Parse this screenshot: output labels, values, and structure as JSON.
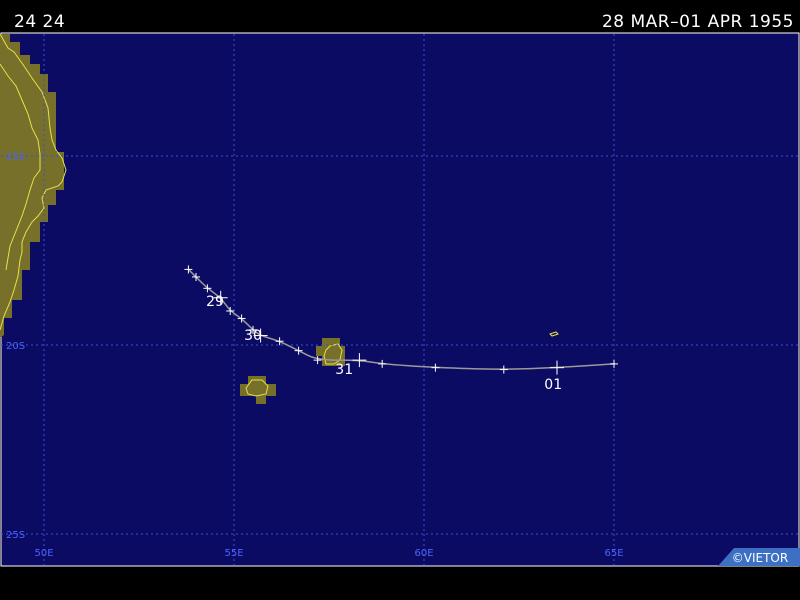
{
  "header": {
    "left_text": "24 24",
    "right_text": "28 MAR–01 APR 1955"
  },
  "map": {
    "colors": {
      "ocean": "#0b0b63",
      "land": "#76702a",
      "coast": "#e8e04a",
      "grid": "#3a4fd8",
      "grid_label": "#4b63ff",
      "track": "#9a9a9a",
      "marker": "#ffffff",
      "badge_bg": "#3d6fc4"
    },
    "lat_labels": [
      {
        "lat": -15,
        "text": "15S"
      },
      {
        "lat": -20,
        "text": "20S"
      },
      {
        "lat": -25,
        "text": "25S"
      }
    ],
    "lon_labels": [
      {
        "lon": 50,
        "text": "50E"
      },
      {
        "lon": 55,
        "text": "55E"
      },
      {
        "lon": 60,
        "text": "60E"
      },
      {
        "lon": 65,
        "text": "65E"
      }
    ],
    "day_labels": [
      {
        "text": "29",
        "lon": 54.5,
        "lat": -18.6
      },
      {
        "text": "30",
        "lon": 55.5,
        "lat": -19.5
      },
      {
        "text": "31",
        "lon": 57.9,
        "lat": -20.4
      },
      {
        "text": "01",
        "lon": 63.4,
        "lat": -20.8
      }
    ],
    "track_points": [
      {
        "lon": 53.8,
        "lat": -18.0
      },
      {
        "lon": 54.0,
        "lat": -18.2
      },
      {
        "lon": 54.3,
        "lat": -18.5
      },
      {
        "lon": 54.65,
        "lat": -18.75,
        "day_start": true
      },
      {
        "lon": 54.9,
        "lat": -19.1
      },
      {
        "lon": 55.2,
        "lat": -19.3
      },
      {
        "lon": 55.5,
        "lat": -19.6
      },
      {
        "lon": 55.7,
        "lat": -19.75,
        "day_start": true
      },
      {
        "lon": 56.2,
        "lat": -19.9
      },
      {
        "lon": 56.7,
        "lat": -20.15
      },
      {
        "lon": 57.2,
        "lat": -20.4
      },
      {
        "lon": 58.3,
        "lat": -20.4,
        "day_start": true
      },
      {
        "lon": 58.9,
        "lat": -20.5
      },
      {
        "lon": 60.3,
        "lat": -20.6
      },
      {
        "lon": 62.1,
        "lat": -20.65
      },
      {
        "lon": 63.5,
        "lat": -20.6,
        "day_start": true
      },
      {
        "lon": 65.0,
        "lat": -20.5
      }
    ],
    "copyright": "©VIETOR"
  }
}
